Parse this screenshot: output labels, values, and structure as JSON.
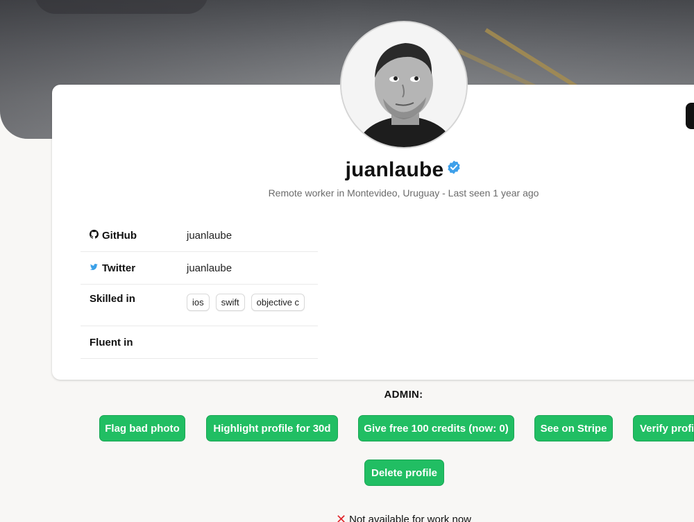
{
  "profile": {
    "username": "juanlaube",
    "subtitle": "Remote worker in Montevideo, Uruguay - Last seen 1 year ago"
  },
  "info": {
    "github_label": "GitHub",
    "github_value": "juanlaube",
    "twitter_label": "Twitter",
    "twitter_value": "juanlaube",
    "skilled_label": "Skilled in",
    "skills": [
      "ios",
      "swift",
      "objective c"
    ],
    "fluent_label": "Fluent in"
  },
  "admin": {
    "title": "ADMIN:",
    "flag_photo": "Flag bad photo",
    "highlight": "Highlight profile for 30d",
    "free_credits": "Give free 100 credits (now: 0)",
    "stripe": "See on Stripe",
    "verify": "Verify profile",
    "delete": "Delete profile"
  },
  "status": {
    "availability": "Not available for work now"
  },
  "colors": {
    "accent_green": "#21be63",
    "verified_blue": "#3ea0ea",
    "unavailable_red": "#e0262b"
  },
  "icons": {
    "github": "github-icon",
    "twitter": "twitter-icon",
    "verified": "verified-badge-icon",
    "unavailable": "cross-mark-icon"
  }
}
